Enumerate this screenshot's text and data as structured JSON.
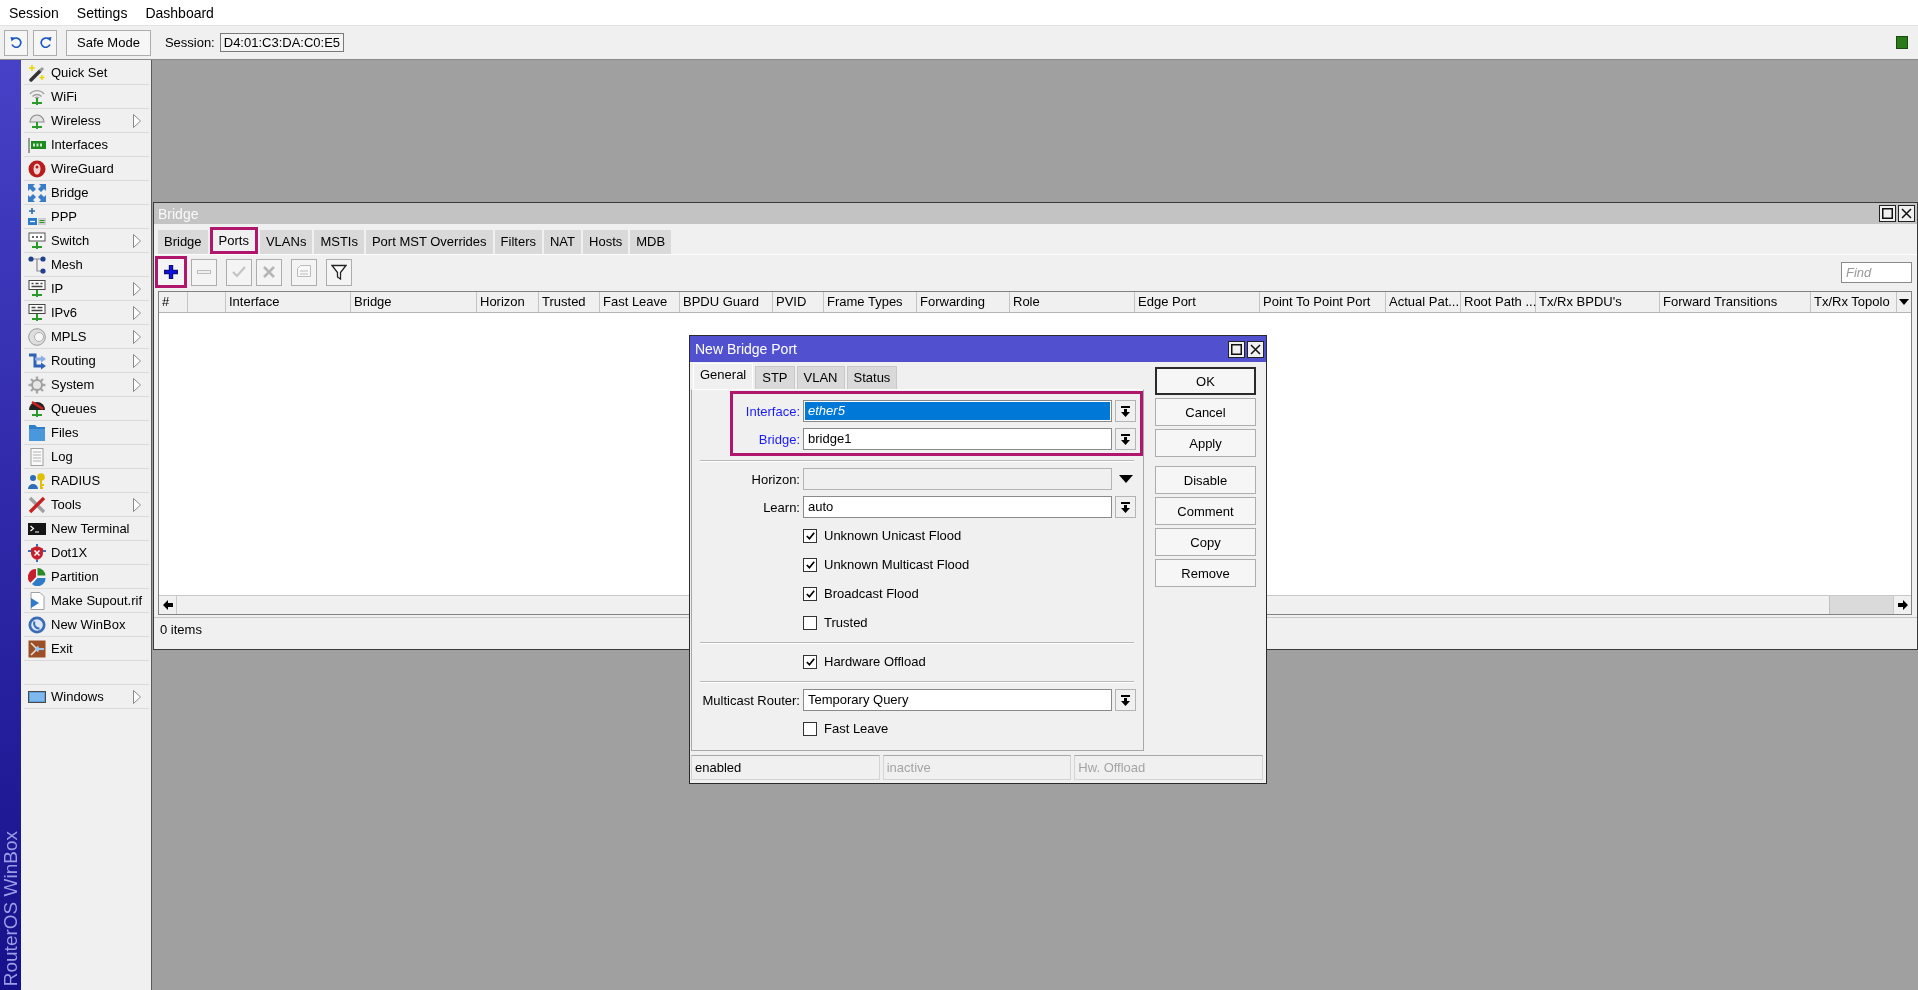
{
  "menu_bar": [
    "Session",
    "Settings",
    "Dashboard"
  ],
  "toolbar": {
    "safe_mode": "Safe Mode",
    "session_label": "Session:",
    "session_value": "D4:01:C3:DA:C0:E5"
  },
  "sidebar": {
    "brand": "RouterOS WinBox",
    "items": [
      {
        "label": "Quick Set",
        "submenu": false
      },
      {
        "label": "WiFi",
        "submenu": false
      },
      {
        "label": "Wireless",
        "submenu": true
      },
      {
        "label": "Interfaces",
        "submenu": false
      },
      {
        "label": "WireGuard",
        "submenu": false
      },
      {
        "label": "Bridge",
        "submenu": false
      },
      {
        "label": "PPP",
        "submenu": false
      },
      {
        "label": "Switch",
        "submenu": true
      },
      {
        "label": "Mesh",
        "submenu": false
      },
      {
        "label": "IP",
        "submenu": true
      },
      {
        "label": "IPv6",
        "submenu": true
      },
      {
        "label": "MPLS",
        "submenu": true
      },
      {
        "label": "Routing",
        "submenu": true
      },
      {
        "label": "System",
        "submenu": true
      },
      {
        "label": "Queues",
        "submenu": false
      },
      {
        "label": "Files",
        "submenu": false
      },
      {
        "label": "Log",
        "submenu": false
      },
      {
        "label": "RADIUS",
        "submenu": false
      },
      {
        "label": "Tools",
        "submenu": true
      },
      {
        "label": "New Terminal",
        "submenu": false
      },
      {
        "label": "Dot1X",
        "submenu": false
      },
      {
        "label": "Partition",
        "submenu": false
      },
      {
        "label": "Make Supout.rif",
        "submenu": false
      },
      {
        "label": "New WinBox",
        "submenu": false
      },
      {
        "label": "Exit",
        "submenu": false
      }
    ],
    "bottom_items": [
      {
        "label": "Windows",
        "submenu": true
      }
    ]
  },
  "bridge_window": {
    "title": "Bridge",
    "tabs": [
      {
        "label": "Bridge",
        "selected": false,
        "highlighted": false
      },
      {
        "label": "Ports",
        "selected": true,
        "highlighted": true
      },
      {
        "label": "VLANs",
        "selected": false,
        "highlighted": false
      },
      {
        "label": "MSTIs",
        "selected": false,
        "highlighted": false
      },
      {
        "label": "Port MST Overrides",
        "selected": false,
        "highlighted": false
      },
      {
        "label": "Filters",
        "selected": false,
        "highlighted": false
      },
      {
        "label": "NAT",
        "selected": false,
        "highlighted": false
      },
      {
        "label": "Hosts",
        "selected": false,
        "highlighted": false
      },
      {
        "label": "MDB",
        "selected": false,
        "highlighted": false
      }
    ],
    "toolbar": {
      "button_groups": [
        {
          "buttons": [
            {
              "disabled": false,
              "highlighted": true
            },
            {
              "disabled": true,
              "highlighted": false
            }
          ]
        },
        {
          "buttons": [
            {
              "disabled": true,
              "highlighted": false
            },
            {
              "disabled": true,
              "highlighted": false
            }
          ]
        },
        {
          "buttons": [
            {
              "disabled": true,
              "highlighted": false
            }
          ]
        },
        {
          "buttons": [
            {
              "disabled": false,
              "highlighted": false
            }
          ]
        }
      ],
      "find": {
        "placeholder": "Find"
      }
    },
    "table": {
      "columns": [
        {
          "kind": "text",
          "label": "#"
        },
        {
          "kind": "blank"
        },
        {
          "kind": "text",
          "label": "Interface"
        },
        {
          "kind": "text",
          "label": "Bridge"
        },
        {
          "kind": "text",
          "label": "Horizon"
        },
        {
          "kind": "text",
          "label": "Trusted"
        },
        {
          "kind": "text",
          "label": "Fast Leave"
        },
        {
          "kind": "text",
          "label": "BPDU Guard"
        },
        {
          "kind": "text",
          "label": "PVID"
        },
        {
          "kind": "text",
          "label": "Frame Types"
        },
        {
          "kind": "text",
          "label": "Forwarding"
        },
        {
          "kind": "text",
          "label": "Role"
        },
        {
          "kind": "text",
          "label": "Edge Port"
        },
        {
          "kind": "text",
          "label": "Point To Point Port"
        },
        {
          "kind": "text",
          "label": "Actual Pat..."
        },
        {
          "kind": "text",
          "label": "Root Path ..."
        },
        {
          "kind": "text",
          "label": "Tx/Rx BPDU's"
        },
        {
          "kind": "text",
          "label": "Forward Transitions"
        },
        {
          "kind": "text",
          "label": "Tx/Rx Topolo"
        }
      ]
    },
    "status": "0 items"
  },
  "dialog": {
    "title": "New Bridge Port",
    "tabs": [
      {
        "label": "General",
        "selected": true
      },
      {
        "label": "STP",
        "selected": false
      },
      {
        "label": "VLAN",
        "selected": false
      },
      {
        "label": "Status",
        "selected": false
      }
    ],
    "sections": [
      {
        "highlighted": true,
        "rows": [
          {
            "kind": "select",
            "label": "Interface:",
            "value": "ether5",
            "required": true,
            "focused": true
          },
          {
            "kind": "select",
            "label": "Bridge:",
            "value": "bridge1",
            "required": true,
            "focused": false
          }
        ]
      },
      {
        "highlighted": false,
        "rows": [
          {
            "kind": "dropdown",
            "label": "Horizon:",
            "required": false,
            "focused": false
          },
          {
            "kind": "select",
            "label": "Learn:",
            "value": "auto",
            "required": false,
            "focused": false
          },
          {
            "kind": "checkbox",
            "label": "Unknown Unicast Flood",
            "checked": true
          },
          {
            "kind": "checkbox",
            "label": "Unknown Multicast Flood",
            "checked": true
          },
          {
            "kind": "checkbox",
            "label": "Broadcast Flood",
            "checked": true
          },
          {
            "kind": "checkbox",
            "label": "Trusted",
            "checked": false
          }
        ]
      },
      {
        "highlighted": false,
        "rows": [
          {
            "kind": "checkbox",
            "label": "Hardware Offload",
            "checked": true
          }
        ]
      },
      {
        "highlighted": false,
        "rows": [
          {
            "kind": "select",
            "label": "Multicast Router:",
            "value": "Temporary Query",
            "required": false,
            "focused": false
          },
          {
            "kind": "checkbox",
            "label": "Fast Leave",
            "checked": false
          }
        ]
      }
    ],
    "button_groups": [
      {
        "buttons": [
          {
            "label": "OK",
            "default": true
          },
          {
            "label": "Cancel",
            "default": false
          },
          {
            "label": "Apply",
            "default": false
          }
        ]
      },
      {
        "buttons": [
          {
            "label": "Disable",
            "default": false
          },
          {
            "label": "Comment",
            "default": false
          },
          {
            "label": "Copy",
            "default": false
          },
          {
            "label": "Remove",
            "default": false
          }
        ]
      }
    ],
    "status": [
      {
        "text": "enabled",
        "disabled": false
      },
      {
        "text": "inactive",
        "disabled": true
      },
      {
        "text": "Hw. Offload",
        "disabled": true
      }
    ]
  }
}
